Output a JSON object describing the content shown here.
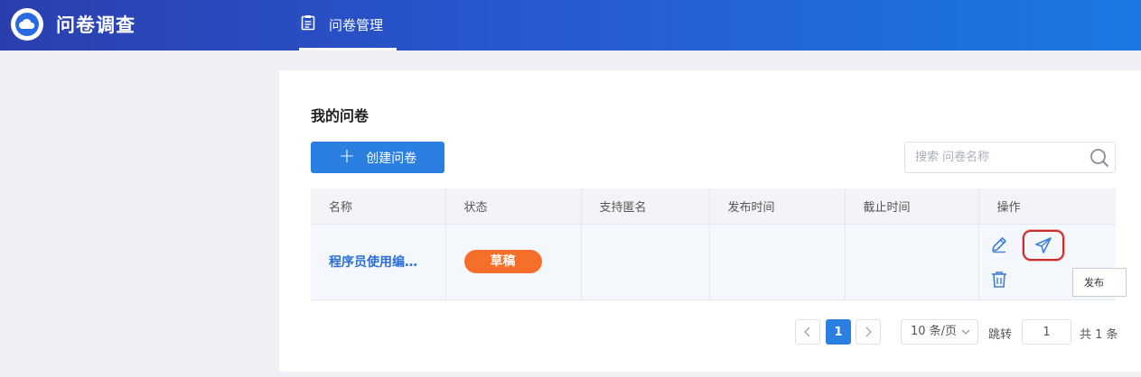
{
  "app": {
    "title": "问卷调查"
  },
  "nav": {
    "tab_label": "问卷管理"
  },
  "page": {
    "title": "我的问卷"
  },
  "toolbar": {
    "create_label": "创建问卷",
    "search_placeholder": "搜索 问卷名称"
  },
  "table": {
    "headers": [
      "名称",
      "状态",
      "支持匿名",
      "发布时间",
      "截止时间",
      "操作"
    ],
    "rows": [
      {
        "name": "程序员使用编…",
        "status": "草稿",
        "anonymous": "",
        "publish_time": "",
        "deadline": ""
      }
    ]
  },
  "actions": {
    "tooltip": "发布"
  },
  "pagination": {
    "current_page": "1",
    "page_size": "10 条/页",
    "jump_label": "跳转",
    "jump_value": "1",
    "total": "共 1 条"
  },
  "colors": {
    "brand": "#2b7fe0",
    "status_draft": "#f56f2a",
    "highlight": "#cc2b2b"
  }
}
